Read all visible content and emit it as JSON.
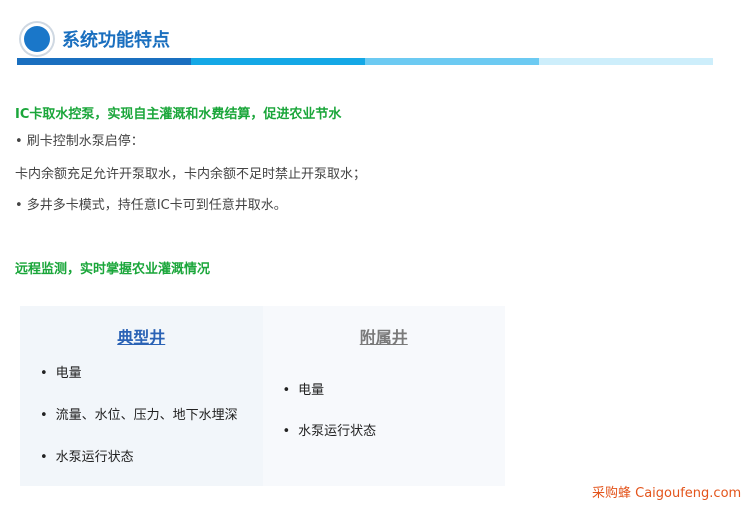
{
  "header": {
    "title": "系统功能特点"
  },
  "section1": {
    "heading": "IC卡取水控泵，实现自主灌溉和水费结算，促进农业节水",
    "lines": [
      "• 刷卡控制水泵启停：",
      "卡内余额充足允许开泵取水，卡内余额不足时禁止开泵取水；",
      "• 多井多卡模式，持任意IC卡可到任意井取水。"
    ]
  },
  "section2": {
    "heading": "远程监测，实时掌握农业灌溉情况"
  },
  "panel": {
    "typical": {
      "title": "典型井",
      "items": [
        "电量",
        "流量、水位、压力、地下水埋深",
        "水泵运行状态"
      ]
    },
    "auxiliary": {
      "title": "附属井",
      "items": [
        "电量",
        "水泵运行状态"
      ]
    }
  },
  "watermark": "采购蜂 Caigoufeng.com",
  "colors": {
    "title": "#1a6fbf",
    "green": "#1aa63a",
    "accent": "#e3541b"
  }
}
